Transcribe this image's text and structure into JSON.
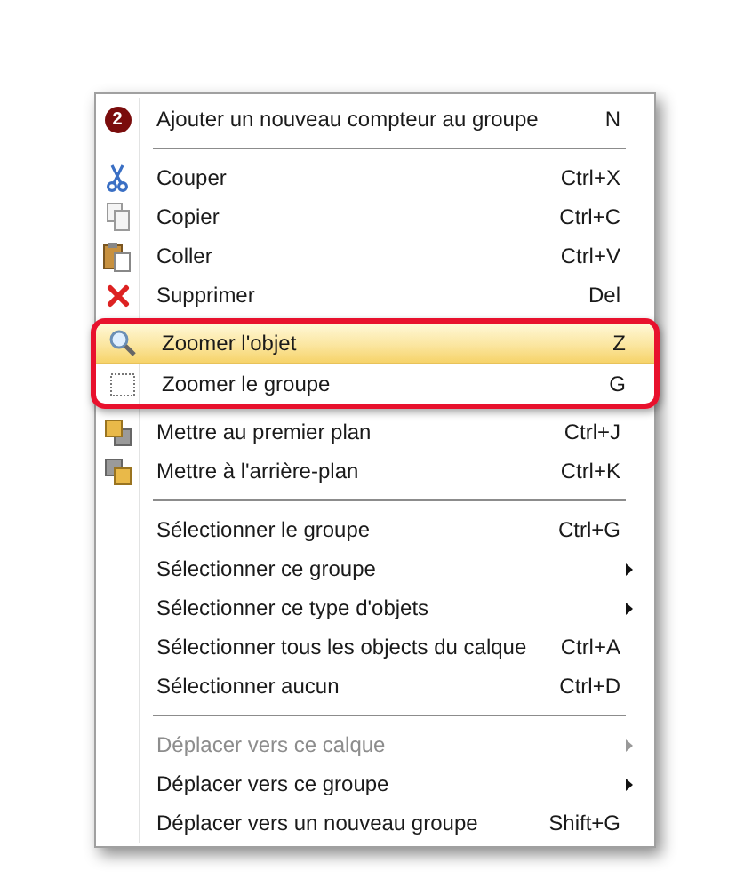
{
  "menu": {
    "sections": [
      {
        "items": [
          {
            "kind": "badge",
            "badge": "2",
            "label": "Ajouter un nouveau compteur au groupe",
            "shortcut": "N",
            "has_submenu": false,
            "disabled": false,
            "selected": false,
            "framed": false
          }
        ]
      },
      {
        "items": [
          {
            "kind": "scissors",
            "label": "Couper",
            "shortcut": "Ctrl+X",
            "has_submenu": false,
            "disabled": false,
            "selected": false,
            "framed": false
          },
          {
            "kind": "copy",
            "label": "Copier",
            "shortcut": "Ctrl+C",
            "has_submenu": false,
            "disabled": false,
            "selected": false,
            "framed": false
          },
          {
            "kind": "paste",
            "label": "Coller",
            "shortcut": "Ctrl+V",
            "has_submenu": false,
            "disabled": false,
            "selected": false,
            "framed": false
          },
          {
            "kind": "delete",
            "label": "Supprimer",
            "shortcut": "Del",
            "has_submenu": false,
            "disabled": false,
            "selected": false,
            "framed": false
          },
          {
            "kind": "zoom",
            "label": "Zoomer l'objet",
            "shortcut": "Z",
            "has_submenu": false,
            "disabled": false,
            "selected": true,
            "framed": true
          },
          {
            "kind": "marquee",
            "label": "Zoomer le groupe",
            "shortcut": "G",
            "has_submenu": false,
            "disabled": false,
            "selected": false,
            "framed": true
          },
          {
            "kind": "front",
            "label": "Mettre au premier plan",
            "shortcut": "Ctrl+J",
            "has_submenu": false,
            "disabled": false,
            "selected": false,
            "framed": false
          },
          {
            "kind": "back",
            "label": "Mettre à l'arrière-plan",
            "shortcut": "Ctrl+K",
            "has_submenu": false,
            "disabled": false,
            "selected": false,
            "framed": false
          }
        ]
      },
      {
        "items": [
          {
            "kind": "plain",
            "label": "Sélectionner le groupe",
            "shortcut": "Ctrl+G",
            "has_submenu": false,
            "disabled": false,
            "selected": false,
            "framed": false
          },
          {
            "kind": "plain",
            "label": "Sélectionner ce groupe",
            "has_submenu": true,
            "disabled": false,
            "selected": false,
            "framed": false
          },
          {
            "kind": "plain",
            "label": "Sélectionner ce type d'objets",
            "has_submenu": true,
            "disabled": false,
            "selected": false,
            "framed": false
          },
          {
            "kind": "plain",
            "label": "Sélectionner tous les objects du calque",
            "shortcut": "Ctrl+A",
            "has_submenu": false,
            "disabled": false,
            "selected": false,
            "framed": false
          },
          {
            "kind": "plain",
            "label": "Sélectionner aucun",
            "shortcut": "Ctrl+D",
            "has_submenu": false,
            "disabled": false,
            "selected": false,
            "framed": false
          }
        ]
      },
      {
        "items": [
          {
            "kind": "plain",
            "label": "Déplacer vers ce calque",
            "has_submenu": true,
            "disabled": true,
            "selected": false,
            "framed": false
          },
          {
            "kind": "plain",
            "label": "Déplacer vers ce groupe",
            "has_submenu": true,
            "disabled": false,
            "selected": false,
            "framed": false
          },
          {
            "kind": "plain",
            "label": "Déplacer vers un nouveau groupe",
            "shortcut": "Shift+G",
            "has_submenu": false,
            "disabled": false,
            "selected": false,
            "framed": false
          }
        ]
      }
    ]
  }
}
